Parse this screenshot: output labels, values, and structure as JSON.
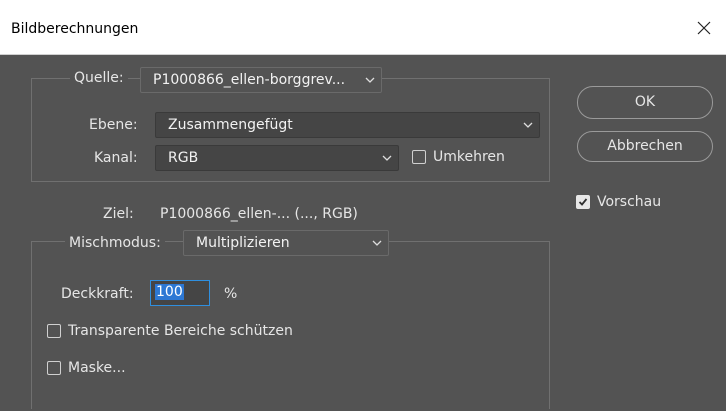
{
  "window": {
    "title": "Bildberechnungen"
  },
  "source_group": {
    "quelle_label": "Quelle:",
    "quelle_value": "P1000866_ellen-borggrev...",
    "ebene_label": "Ebene:",
    "ebene_value": "Zusammengefügt",
    "kanal_label": "Kanal:",
    "kanal_value": "RGB",
    "invert_label": "Umkehren",
    "invert_checked": false
  },
  "target": {
    "label": "Ziel:",
    "value": "P1000866_ellen-... (..., RGB)"
  },
  "blend_group": {
    "mode_label": "Mischmodus:",
    "mode_value": "Multiplizieren",
    "opacity_label": "Deckkraft:",
    "opacity_value": "100",
    "opacity_unit": "%",
    "preserve_transparency_label": "Transparente Bereiche schützen",
    "preserve_transparency_checked": false,
    "mask_label": "Maske...",
    "mask_checked": false
  },
  "buttons": {
    "ok_label": "OK",
    "cancel_label": "Abbrechen"
  },
  "preview": {
    "label": "Vorschau",
    "checked": true
  },
  "colors": {
    "dialog_bg": "#535353",
    "field_bg": "#454545",
    "focus": "#2f8fdf"
  }
}
